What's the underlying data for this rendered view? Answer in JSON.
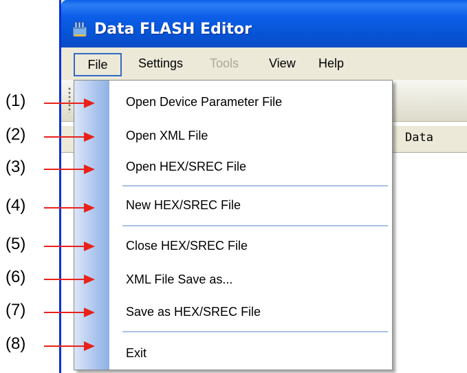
{
  "window": {
    "title": "Data FLASH Editor"
  },
  "menubar": {
    "items": [
      {
        "label": "File",
        "enabled": true
      },
      {
        "label": "Settings",
        "enabled": true
      },
      {
        "label": "Tools",
        "enabled": false
      },
      {
        "label": "View",
        "enabled": true
      },
      {
        "label": "Help",
        "enabled": true
      }
    ]
  },
  "grid": {
    "columns": [
      "Data"
    ]
  },
  "file_menu": {
    "items": [
      "Open Device Parameter File",
      "Open XML File",
      "Open HEX/SREC File",
      "New HEX/SREC File",
      "Close HEX/SREC File",
      "XML File Save as...",
      "Save as HEX/SREC File",
      "Exit"
    ]
  },
  "annotations": [
    "(1)",
    "(2)",
    "(3)",
    "(4)",
    "(5)",
    "(6)",
    "(7)",
    "(8)"
  ],
  "colors": {
    "titlebar": "#0654d6",
    "menu_strip": "#8fb0e6",
    "separator": "#a9bfe6",
    "arrow": "#e8211a"
  }
}
